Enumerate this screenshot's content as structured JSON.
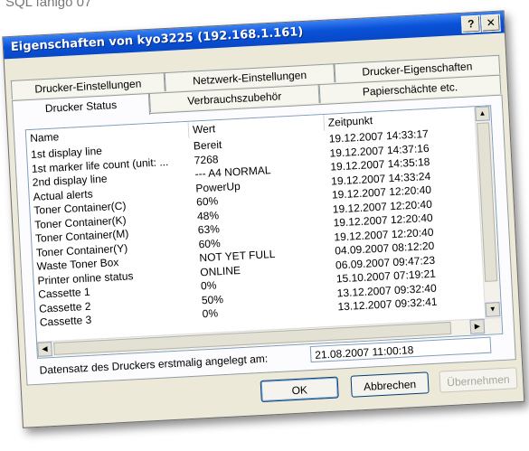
{
  "caption_top": "SQL fahigo 07",
  "window": {
    "title": "Eigenschaften von kyo3225  (192.168.1.161)",
    "help_label": "?",
    "close_label": "✕"
  },
  "tabs": {
    "row1": [
      "Drucker-Einstellungen",
      "Netzwerk-Einstellungen",
      "Drucker-Eigenschaften"
    ],
    "row2": [
      "Drucker Status",
      "Verbrauchszubehör",
      "Papierschächte etc."
    ],
    "active": "Drucker Status"
  },
  "table": {
    "columns": [
      "Name",
      "Wert",
      "Zeitpunkt"
    ],
    "rows": [
      {
        "name": "1st display line",
        "value": "Bereit",
        "time": "19.12.2007 14:33:17"
      },
      {
        "name": "1st marker life count (unit: ...",
        "value": "7268",
        "time": "19.12.2007 14:37:16"
      },
      {
        "name": "2nd display line",
        "value": "--- A4 NORMAL",
        "time": "19.12.2007 14:35:18"
      },
      {
        "name": "Actual alerts",
        "value": "PowerUp",
        "time": "19.12.2007 14:33:24"
      },
      {
        "name": "Toner Container(C)",
        "value": "60%",
        "time": "19.12.2007 12:20:40"
      },
      {
        "name": "Toner Container(K)",
        "value": "48%",
        "time": "19.12.2007 12:20:40"
      },
      {
        "name": "Toner Container(M)",
        "value": "63%",
        "time": "19.12.2007 12:20:40"
      },
      {
        "name": "Toner Container(Y)",
        "value": "60%",
        "time": "19.12.2007 12:20:40"
      },
      {
        "name": "Waste Toner Box",
        "value": "NOT YET FULL",
        "time": "04.09.2007 08:12:20"
      },
      {
        "name": "Printer online status",
        "value": "ONLINE",
        "time": "06.09.2007 09:47:23"
      },
      {
        "name": "Cassette 1",
        "value": "0%",
        "time": "15.10.2007 07:19:21"
      },
      {
        "name": "Cassette 2",
        "value": "50%",
        "time": "13.12.2007 09:32:40"
      },
      {
        "name": "Cassette 3",
        "value": "0%",
        "time": "13.12.2007 09:32:41"
      }
    ]
  },
  "footer": {
    "label": "Datensatz des Druckers erstmalig angelegt am:",
    "value": "21.08.2007  11:00:18"
  },
  "buttons": {
    "ok": "OK",
    "cancel": "Abbrechen",
    "apply": "Übernehmen"
  },
  "colors": {
    "titlebar": "#0a52d8",
    "dialog_bg": "#ece9d8"
  }
}
